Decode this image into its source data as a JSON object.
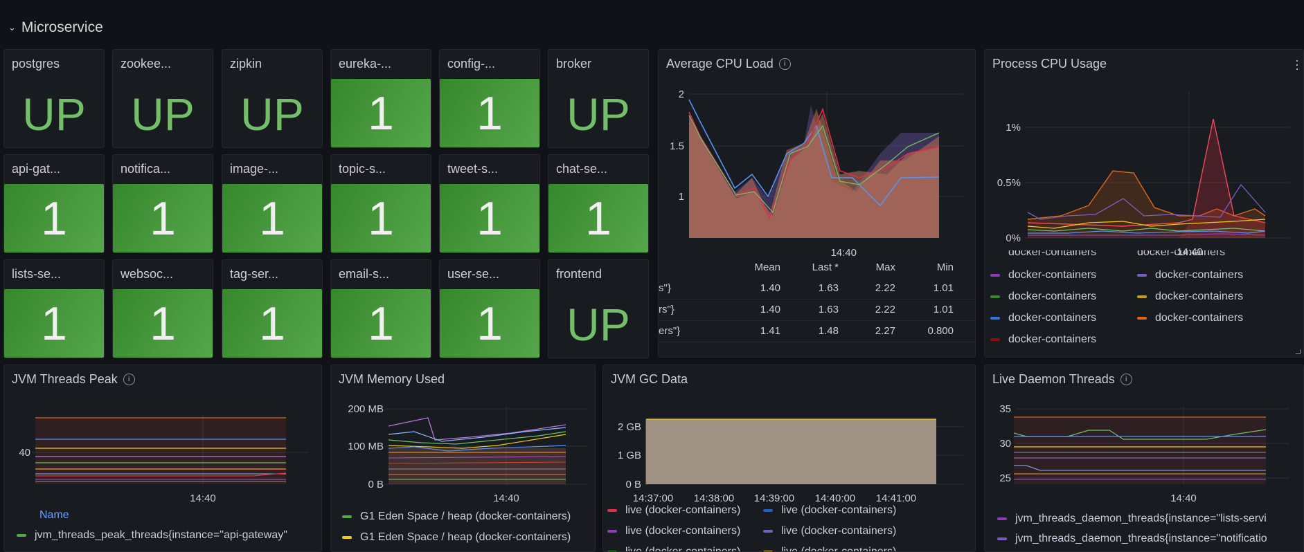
{
  "row": {
    "title": "Microservice"
  },
  "stats": [
    {
      "name": "postgres",
      "value": "UP",
      "kind": "text"
    },
    {
      "name": "zookee...",
      "value": "UP",
      "kind": "text"
    },
    {
      "name": "zipkin",
      "value": "UP",
      "kind": "text"
    },
    {
      "name": "eureka-...",
      "value": "1",
      "kind": "box"
    },
    {
      "name": "config-...",
      "value": "1",
      "kind": "box"
    },
    {
      "name": "broker",
      "value": "UP",
      "kind": "text"
    },
    {
      "name": "api-gat...",
      "value": "1",
      "kind": "box"
    },
    {
      "name": "notifica...",
      "value": "1",
      "kind": "box"
    },
    {
      "name": "image-...",
      "value": "1",
      "kind": "box"
    },
    {
      "name": "topic-s...",
      "value": "1",
      "kind": "box"
    },
    {
      "name": "tweet-s...",
      "value": "1",
      "kind": "box"
    },
    {
      "name": "chat-se...",
      "value": "1",
      "kind": "box"
    },
    {
      "name": "lists-se...",
      "value": "1",
      "kind": "box"
    },
    {
      "name": "websoc...",
      "value": "1",
      "kind": "box"
    },
    {
      "name": "tag-ser...",
      "value": "1",
      "kind": "box"
    },
    {
      "name": "email-s...",
      "value": "1",
      "kind": "box"
    },
    {
      "name": "user-se...",
      "value": "1",
      "kind": "box"
    },
    {
      "name": "frontend",
      "value": "UP",
      "kind": "text"
    }
  ],
  "cpu_load": {
    "title": "Average CPU Load",
    "x_tick": "14:40",
    "y_ticks": [
      "2",
      "1.5",
      "1"
    ],
    "table": {
      "headers": [
        "Mean",
        "Last *",
        "Max",
        "Min"
      ],
      "rows": [
        {
          "name": "s\"}",
          "mean": "1.40",
          "last": "1.63",
          "max": "2.22",
          "min": "1.01"
        },
        {
          "name": "rs\"}",
          "mean": "1.40",
          "last": "1.63",
          "max": "2.22",
          "min": "1.01"
        },
        {
          "name": "ers\"}",
          "mean": "1.41",
          "last": "1.48",
          "max": "2.27",
          "min": "0.800"
        }
      ]
    }
  },
  "process_cpu": {
    "title": "Process CPU Usage",
    "x_tick": "14:40",
    "y_ticks": [
      "1%",
      "0.5%",
      "0%"
    ],
    "legend": [
      {
        "label": "docker-containers",
        "color": "#8f3bb8"
      },
      {
        "label": "docker-containers",
        "color": "#7a5fc0"
      },
      {
        "label": "docker-containers",
        "color": "#37872d"
      },
      {
        "label": "docker-containers",
        "color": "#c4a000"
      },
      {
        "label": "docker-containers",
        "color": "#3274d9"
      },
      {
        "label": "docker-containers",
        "color": "#e0661a"
      },
      {
        "label": "docker-containers",
        "color": "#8b0f0f"
      }
    ],
    "cut_legend": [
      "docker-containers",
      "docker-containers"
    ]
  },
  "jvm_threads": {
    "title": "JVM Threads Peak",
    "y_tick": "40",
    "x_tick": "14:40",
    "legend_header": "Name",
    "legend": [
      {
        "label": "jvm_threads_peak_threads{instance=\"api-gateway\"",
        "color": "#56a64b"
      }
    ]
  },
  "jvm_memory": {
    "title": "JVM Memory Used",
    "y_ticks": [
      "200 MB",
      "100 MB",
      "0 B"
    ],
    "x_tick": "14:40",
    "legend": [
      {
        "label": "G1 Eden Space / heap (docker-containers)",
        "color": "#56a64b"
      },
      {
        "label": "G1 Eden Space / heap (docker-containers)",
        "color": "#f2cc0c"
      }
    ]
  },
  "jvm_gc": {
    "title": "JVM GC Data",
    "y_ticks": [
      "2 GB",
      "1 GB",
      "0 B"
    ],
    "x_ticks": [
      "14:37:00",
      "14:38:00",
      "14:39:00",
      "14:40:00",
      "14:41:00"
    ],
    "legend": [
      {
        "label": "live (docker-containers)",
        "color": "#e02f44"
      },
      {
        "label": "live (docker-containers)",
        "color": "#1f60c4"
      },
      {
        "label": "live (docker-containers)",
        "color": "#8f3bb8"
      },
      {
        "label": "live (docker-containers)",
        "color": "#7a5fc0"
      }
    ],
    "cut_legend": [
      "live (docker-containers)",
      "live (docker-containers)"
    ]
  },
  "daemon_threads": {
    "title": "Live Daemon Threads",
    "y_ticks": [
      "35",
      "30",
      "25"
    ],
    "x_tick": "14:40",
    "legend": [
      {
        "label": "jvm_threads_daemon_threads{instance=\"lists-servi",
        "color": "#8f3bb8"
      },
      {
        "label": "jvm_threads_daemon_threads{instance=\"notificatio",
        "color": "#7a5fc0"
      }
    ]
  }
}
